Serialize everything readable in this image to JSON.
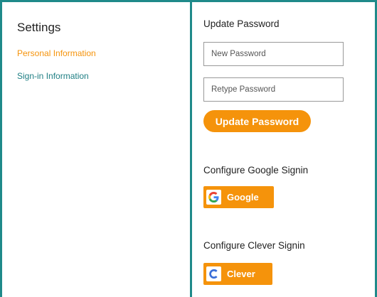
{
  "sidebar": {
    "title": "Settings",
    "items": [
      {
        "label": "Personal Information",
        "color": "#f5930b"
      },
      {
        "label": "Sign-in Information",
        "color": "#1f7f84"
      }
    ]
  },
  "main": {
    "update_password": {
      "heading": "Update Password",
      "new_password_placeholder": "New Password",
      "retype_password_placeholder": "Retype Password",
      "button_label": "Update Password"
    },
    "google": {
      "heading": "Configure Google Signin",
      "button_label": "Google",
      "icon": "google-g-icon"
    },
    "clever": {
      "heading": "Configure Clever Signin",
      "button_label": "Clever",
      "icon": "clever-c-icon"
    }
  },
  "colors": {
    "accent": "#f5930b",
    "border": "#1f8a8a",
    "link": "#1f7f84"
  }
}
